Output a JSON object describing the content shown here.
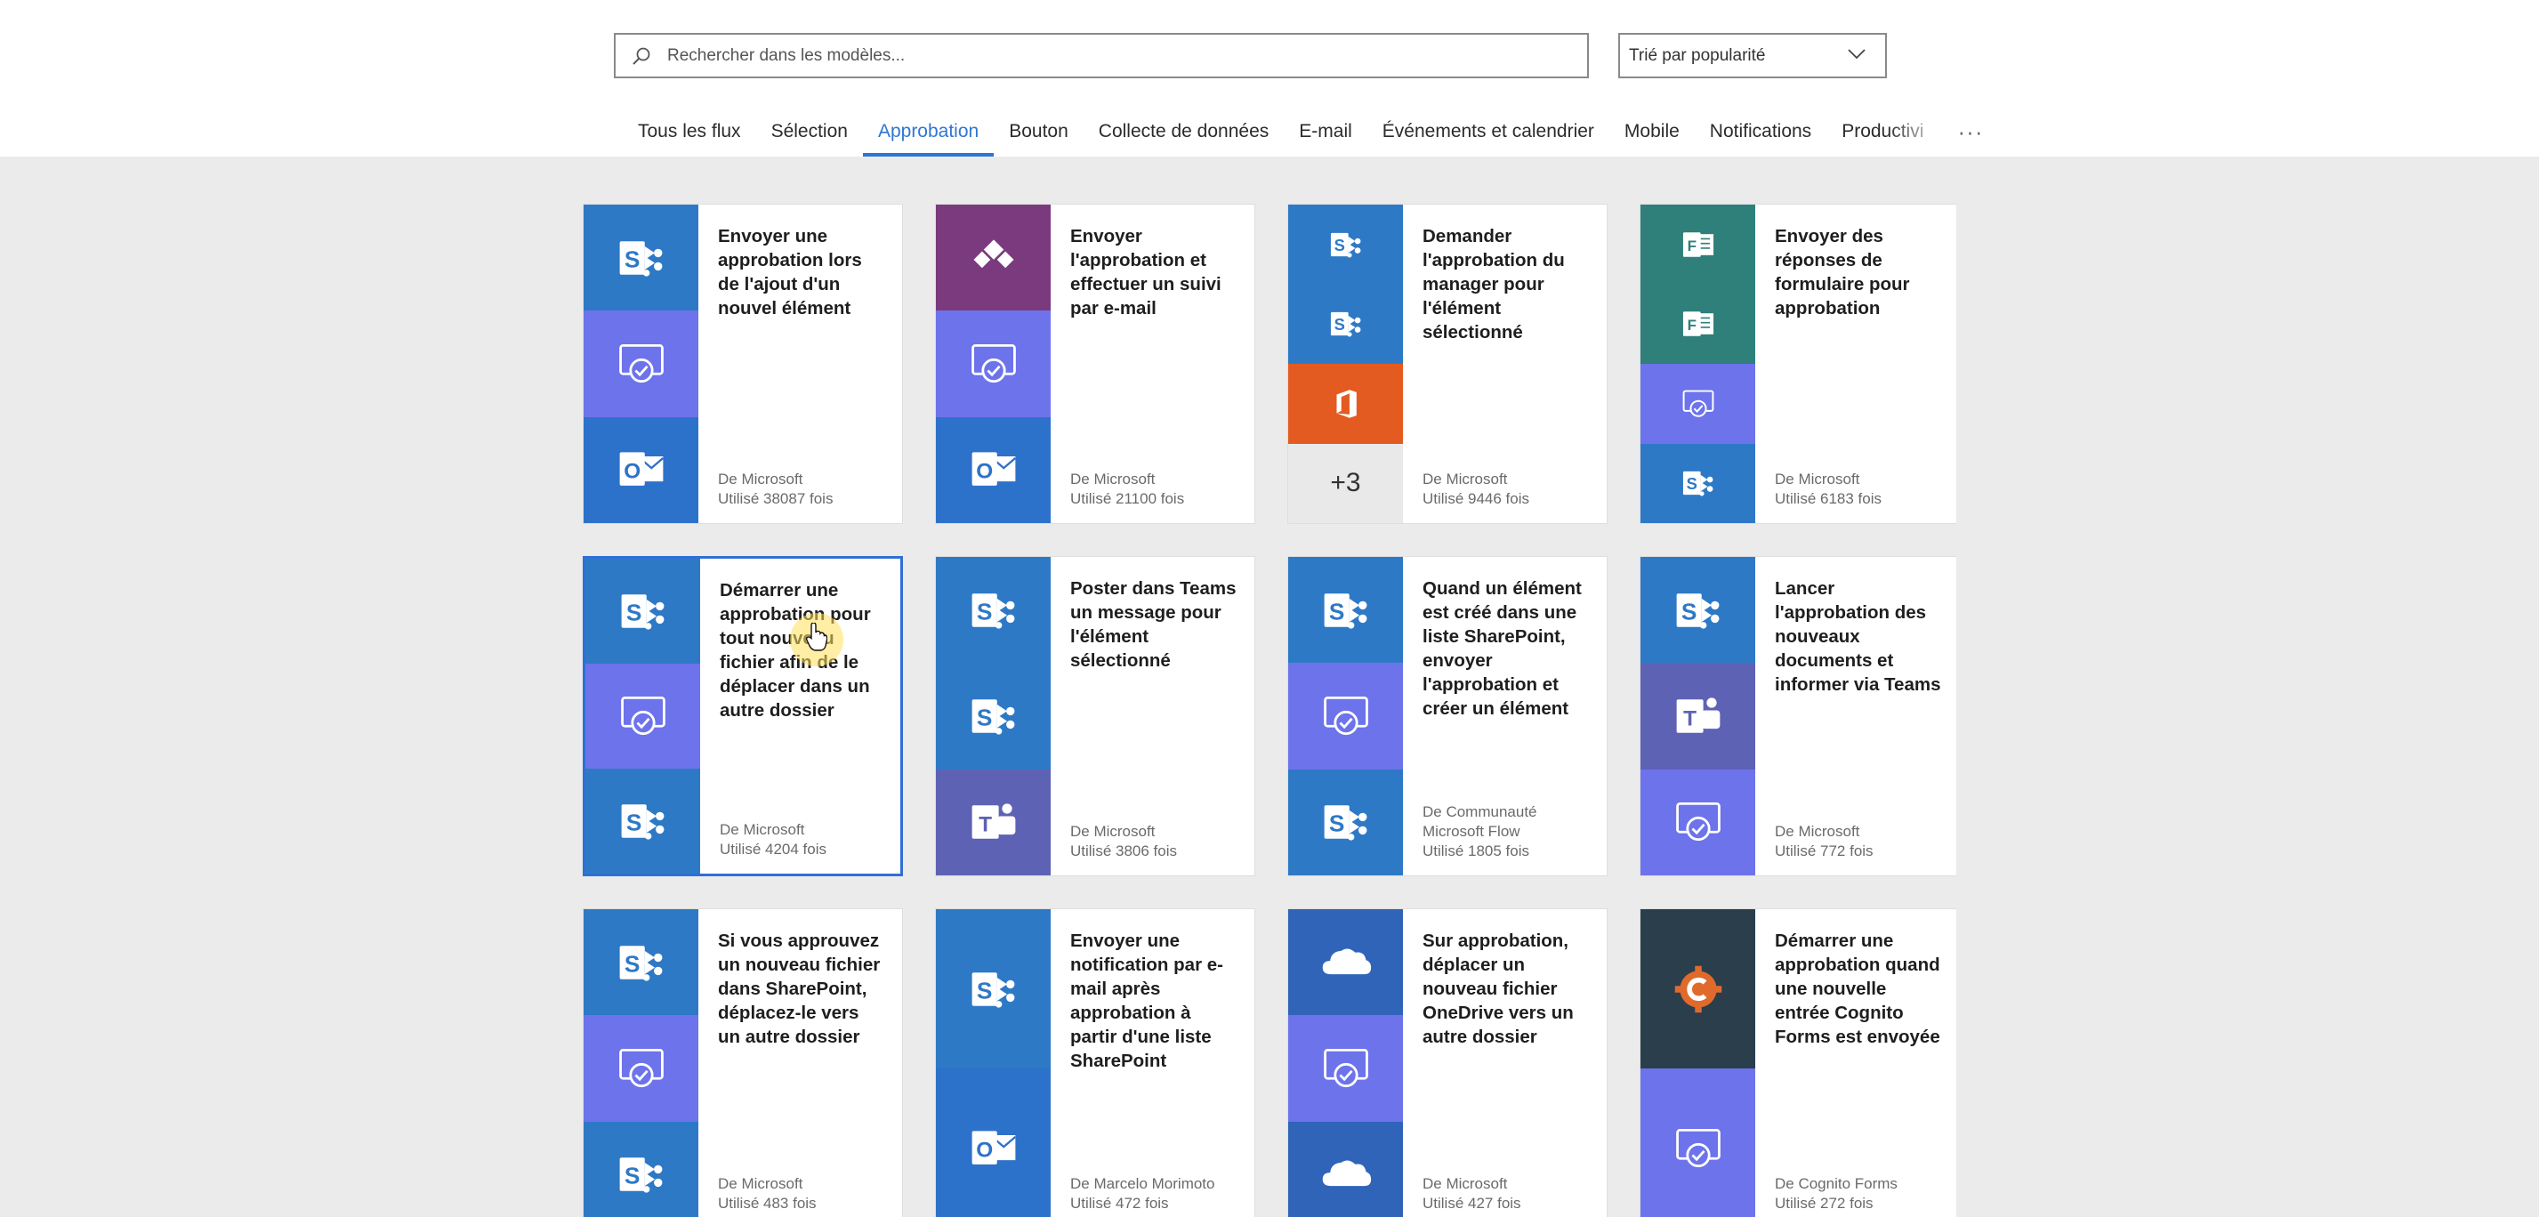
{
  "search": {
    "placeholder": "Rechercher dans les modèles..."
  },
  "sort": {
    "value": "Trié par popularité"
  },
  "tabs": [
    {
      "label": "Tous les flux"
    },
    {
      "label": "Sélection"
    },
    {
      "label": "Approbation",
      "active": true
    },
    {
      "label": "Bouton"
    },
    {
      "label": "Collecte de données"
    },
    {
      "label": "E-mail"
    },
    {
      "label": "Événements et calendrier"
    },
    {
      "label": "Mobile"
    },
    {
      "label": "Notifications"
    },
    {
      "label": "Productivi"
    }
  ],
  "more_label": "···",
  "colors": {
    "accent": "#2f76d2",
    "sharepoint": "#2e79c6",
    "approvals": "#6d73eb",
    "outlook": "#2d72ca",
    "office": "#e35b20",
    "forms": "#2f7f7a",
    "teams": "#5d62b5",
    "onedrive": "#2f64b8",
    "cognito": "#2a3e4c"
  },
  "cards": [
    {
      "title": "Envoyer une approbation lors de l'ajout d'un nouvel élément",
      "author": "De Microsoft",
      "usage": "Utilisé 38087 fois",
      "icons": [
        "sharepoint",
        "approvals",
        "outlook"
      ]
    },
    {
      "title": "Envoyer l'approbation et effectuer un suivi par e-mail",
      "author": "De Microsoft",
      "usage": "Utilisé 21100 fois",
      "icons": [
        "powerapps",
        "approvals",
        "outlook"
      ]
    },
    {
      "title": "Demander l'approbation du manager pour l'élément sélectionné",
      "author": "De Microsoft",
      "usage": "Utilisé 9446 fois",
      "icons": [
        "sharepoint",
        "sharepoint",
        "office",
        "more"
      ],
      "more_count": "+3"
    },
    {
      "title": "Envoyer des réponses de formulaire pour approbation",
      "author": "De Microsoft",
      "usage": "Utilisé 6183 fois",
      "icons": [
        "forms",
        "forms",
        "approvals",
        "sharepoint"
      ]
    },
    {
      "title": "Démarrer une approbation pour tout nouveau fichier afin de le déplacer dans un autre dossier",
      "author": "De Microsoft",
      "usage": "Utilisé 4204 fois",
      "icons": [
        "sharepoint",
        "approvals",
        "sharepoint"
      ],
      "selected": true
    },
    {
      "title": "Poster dans Teams un message pour l'élément sélectionné",
      "author": "De Microsoft",
      "usage": "Utilisé 3806 fois",
      "icons": [
        "sharepoint",
        "sharepoint",
        "teams"
      ]
    },
    {
      "title": "Quand un élément est créé dans une liste SharePoint, envoyer l'approbation et créer un élément",
      "author": "De Communauté Microsoft Flow",
      "usage": "Utilisé 1805 fois",
      "icons": [
        "sharepoint",
        "approvals",
        "sharepoint"
      ]
    },
    {
      "title": "Lancer l'approbation des nouveaux documents et informer via Teams",
      "author": "De Microsoft",
      "usage": "Utilisé 772 fois",
      "icons": [
        "sharepoint",
        "teams",
        "approvals"
      ]
    },
    {
      "title": "Si vous approuvez un nouveau fichier dans SharePoint, déplacez-le vers un autre dossier",
      "author": "De Microsoft",
      "usage": "Utilisé 483 fois",
      "icons": [
        "sharepoint",
        "approvals",
        "sharepoint"
      ]
    },
    {
      "title": "Envoyer une notification par e-mail après approbation à partir d'une liste SharePoint",
      "author": "De Marcelo Morimoto",
      "usage": "Utilisé 472 fois",
      "icons": [
        "sharepoint",
        "outlook"
      ]
    },
    {
      "title": "Sur approbation, déplacer un nouveau fichier OneDrive vers un autre dossier",
      "author": "De Microsoft",
      "usage": "Utilisé 427 fois",
      "icons": [
        "onedrive",
        "approvals",
        "onedrive"
      ]
    },
    {
      "title": "Démarrer une approbation quand une nouvelle entrée Cognito Forms est envoyée",
      "author": "De Cognito Forms",
      "usage": "Utilisé 272 fois",
      "icons": [
        "cognito",
        "approvals"
      ]
    }
  ]
}
